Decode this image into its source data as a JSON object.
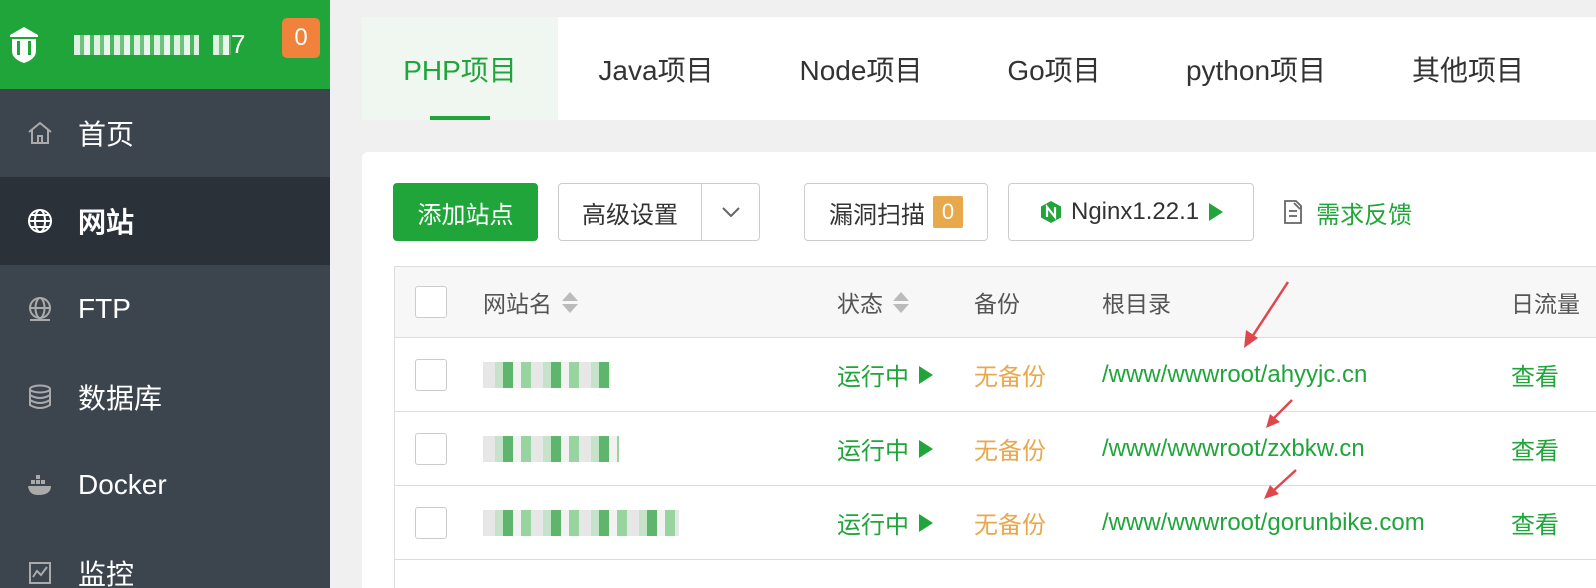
{
  "header": {
    "title_tail": "7",
    "notif_count": "0"
  },
  "sidebar": {
    "items": [
      {
        "label": "首页",
        "icon": "home-icon"
      },
      {
        "label": "网站",
        "icon": "globe-icon",
        "active": true
      },
      {
        "label": "FTP",
        "icon": "ftp-icon"
      },
      {
        "label": "数据库",
        "icon": "database-icon"
      },
      {
        "label": "Docker",
        "icon": "docker-icon"
      },
      {
        "label": "监控",
        "icon": "monitor-icon"
      }
    ]
  },
  "tabs": [
    {
      "label": "PHP项目",
      "active": true
    },
    {
      "label": "Java项目"
    },
    {
      "label": "Node项目"
    },
    {
      "label": "Go项目"
    },
    {
      "label": "python项目"
    },
    {
      "label": "其他项目"
    }
  ],
  "toolbar": {
    "add_site": "添加站点",
    "advanced": "高级设置",
    "scan": "漏洞扫描",
    "scan_count": "0",
    "nginx": "Nginx1.22.1",
    "feedback": "需求反馈"
  },
  "table": {
    "columns": {
      "name": "网站名",
      "status": "状态",
      "backup": "备份",
      "root": "根目录",
      "flow": "日流量"
    },
    "rows": [
      {
        "status": "运行中",
        "backup": "无备份",
        "root": "/www/wwwroot/ahyyjc.cn",
        "action": "查看"
      },
      {
        "status": "运行中",
        "backup": "无备份",
        "root": "/www/wwwroot/zxbkw.cn",
        "action": "查看"
      },
      {
        "status": "运行中",
        "backup": "无备份",
        "root": "/www/wwwroot/gorunbike.com",
        "action": "查看"
      }
    ]
  },
  "colors": {
    "accent": "#20a53a",
    "sidebar_bg": "#3c444d",
    "warning": "#e8a84c",
    "arrow": "#e0474c"
  }
}
